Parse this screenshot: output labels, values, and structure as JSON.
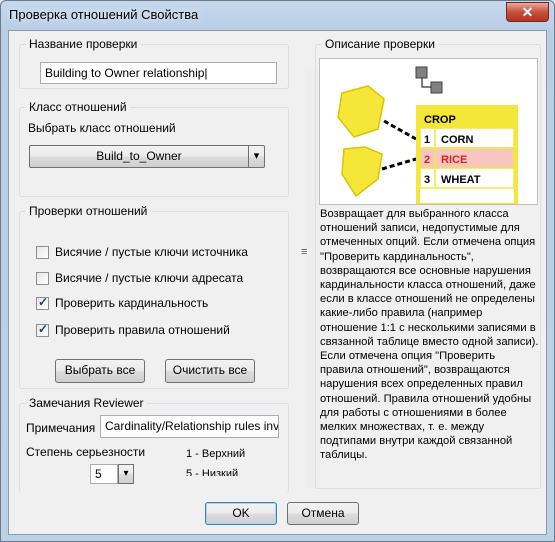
{
  "window": {
    "title": "Проверка отношений Свойства",
    "close": "✕"
  },
  "check_name": {
    "group_label": "Название проверки",
    "value": "Building to Owner relationship|"
  },
  "relation_class": {
    "group_label": "Класс отношений",
    "prompt": "Выбрать класс отношений",
    "selected": "Build_to_Owner",
    "dropdown_glyph": "▾"
  },
  "relation_checks": {
    "group_label": "Проверки отношений",
    "options": [
      {
        "label": "Висячие / пустые ключи источника",
        "checked": false
      },
      {
        "label": "Висячие / пустые ключи адресата",
        "checked": false
      },
      {
        "label": "Проверить кардинальность",
        "checked": true
      },
      {
        "label": "Проверить правила отношений",
        "checked": true
      }
    ],
    "select_all": "Выбрать все",
    "clear_all": "Очистить все"
  },
  "reviewer": {
    "group_label": "Замечания Reviewer",
    "notes_label": "Примечания",
    "notes_value": "Cardinality/Relationship rules invlid",
    "severity_label": "Степень серьезности",
    "severity_value": "5",
    "severity_hint": "1 - Верхний",
    "severity_hint2": "5 - Низкий"
  },
  "description": {
    "group_label": "Описание проверки",
    "table_header": "CROP",
    "rows": [
      {
        "num": "1",
        "name": "CORN"
      },
      {
        "num": "2",
        "name": "RICE"
      },
      {
        "num": "3",
        "name": "WHEAT"
      }
    ],
    "text": "Возвращает для выбранного класса отношений записи, недопустимые для отмеченных опций. Если отмечена опция \"Проверить кардинальность\", возвращаются все основные нарушения кардинальности класса отношений, даже если в классе отношений не определены какие-либо правила (например отношение 1:1 с несколькими записями в связанной таблице вместо одной записи). Если отмечена опция \"Проверить правила отношений\", возвращаются нарушения всех определенных правил отношений. Правила отношений удобны для работы с отношениями в более мелких множествах, т. е. между подтипами внутри каждой связанной таблицы."
  },
  "buttons": {
    "ok": "OK",
    "cancel": "Отмена"
  },
  "colors": {
    "highlight_yellow": "#f5e63a",
    "error_red": "#e0201b",
    "error_bg": "#f5c6c2"
  }
}
